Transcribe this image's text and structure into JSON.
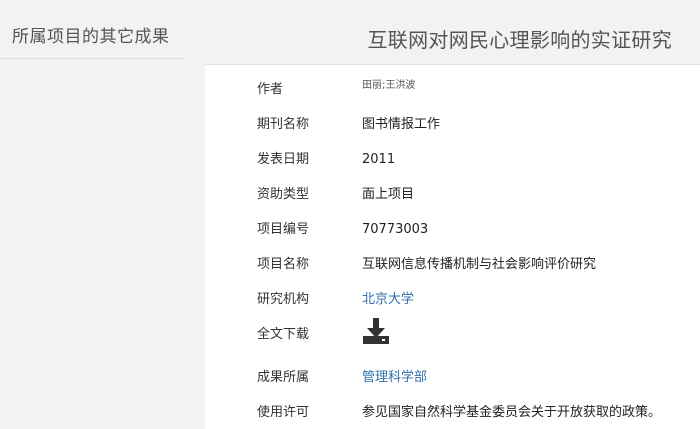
{
  "sidebar": {
    "title": "所属项目的其它成果"
  },
  "page": {
    "title": "互联网对网民心理影响的实证研究"
  },
  "details": [
    {
      "key": "authors",
      "label": "作者",
      "value": "田丽;王洪波"
    },
    {
      "key": "journal",
      "label": "期刊名称",
      "value": "图书情报工作"
    },
    {
      "key": "year",
      "label": "发表日期",
      "value": "2011"
    },
    {
      "key": "funding_type",
      "label": "资助类型",
      "value": "面上项目"
    },
    {
      "key": "project_number",
      "label": "项目编号",
      "value": "70773003"
    },
    {
      "key": "project_name",
      "label": "项目名称",
      "value": "互联网信息传播机制与社会影响评价研究"
    },
    {
      "key": "institution",
      "label": "研究机构",
      "value": "北京大学"
    },
    {
      "key": "download",
      "label": "全文下载",
      "icon": "download-icon"
    },
    {
      "key": "department",
      "label": "成果所属",
      "value": "管理科学部"
    },
    {
      "key": "license",
      "label": "使用许可",
      "value": "参见国家自然科学基金委员会关于开放获取的政策。"
    }
  ],
  "colors": {
    "link": "#2f6fae",
    "background": "#f2f2f2",
    "card": "#ffffff",
    "icon": "#333333"
  }
}
